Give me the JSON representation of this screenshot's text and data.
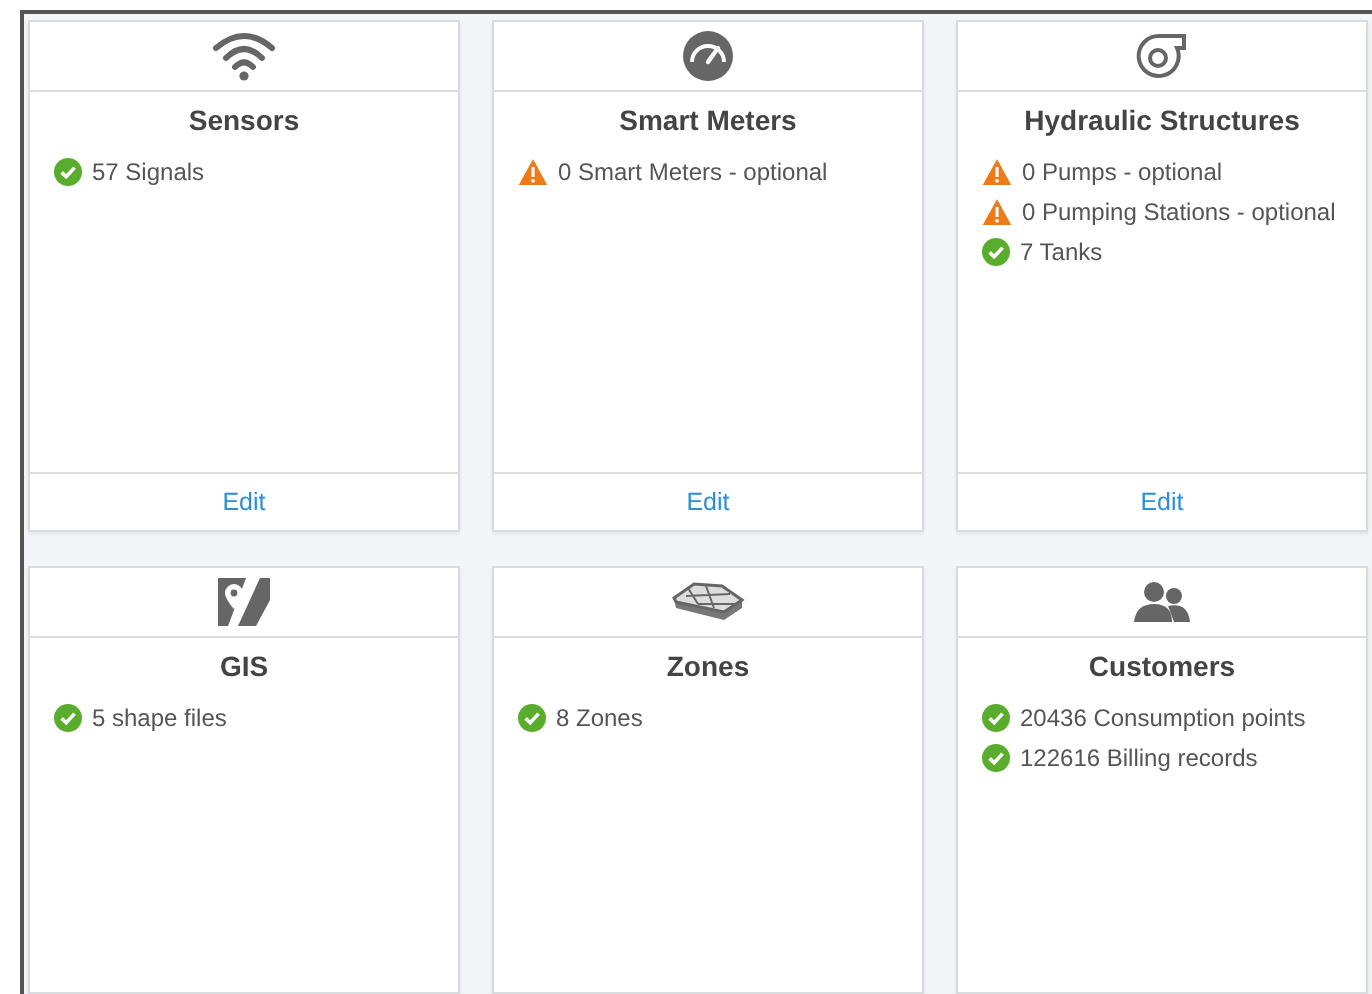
{
  "cards": [
    {
      "title": "Sensors",
      "items": [
        {
          "warning": false,
          "text": "57 Signals"
        }
      ],
      "action": "Edit"
    },
    {
      "title": "Smart Meters",
      "items": [
        {
          "warning": true,
          "text": "0 Smart Meters - optional"
        }
      ],
      "action": "Edit"
    },
    {
      "title": "Hydraulic Structures",
      "items": [
        {
          "warning": true,
          "text": "0 Pumps - optional"
        },
        {
          "warning": true,
          "text": "0 Pumping Stations - optional"
        },
        {
          "warning": false,
          "text": "7 Tanks"
        }
      ],
      "action": "Edit"
    },
    {
      "title": "GIS",
      "items": [
        {
          "warning": false,
          "text": "5 shape files"
        }
      ]
    },
    {
      "title": "Zones",
      "items": [
        {
          "warning": false,
          "text": "8 Zones"
        }
      ]
    },
    {
      "title": "Customers",
      "items": [
        {
          "warning": false,
          "text": "20436 Consumption points"
        },
        {
          "warning": false,
          "text": "122616 Billing records"
        }
      ]
    }
  ]
}
